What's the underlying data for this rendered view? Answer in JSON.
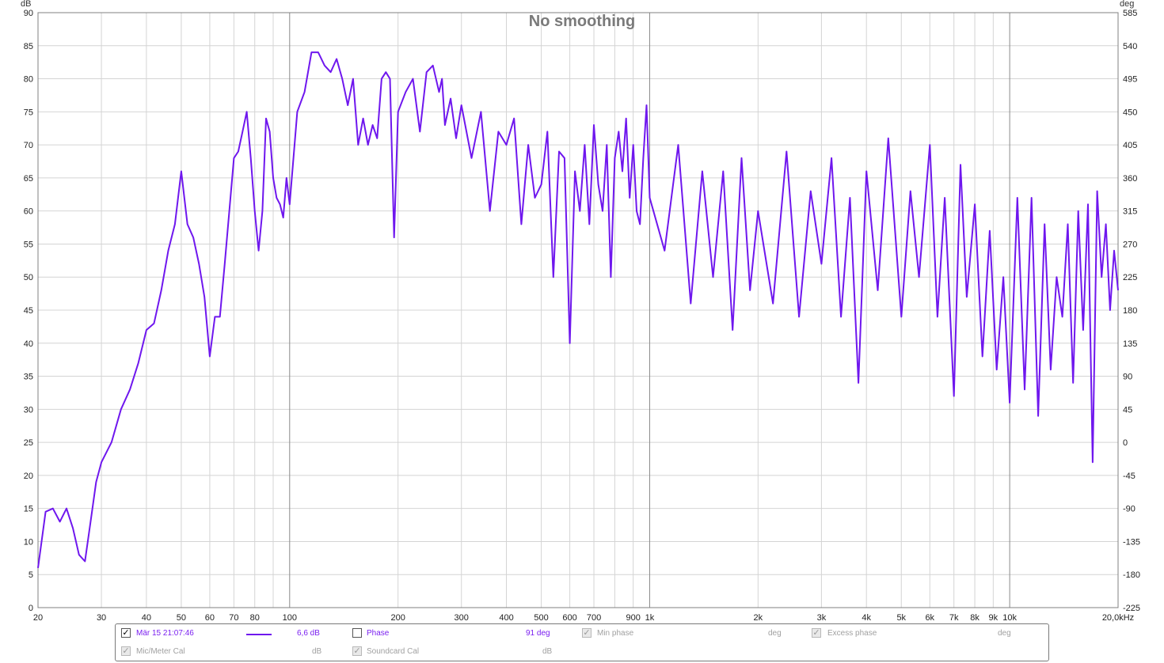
{
  "chart_data": {
    "type": "line",
    "title": "No smoothing",
    "y_left_unit": "dB",
    "y_right_unit": "deg",
    "x_unit_label": "kHz",
    "x_scale": "log",
    "xlim": [
      20,
      20000
    ],
    "ylim": [
      0,
      90
    ],
    "ylim_right": [
      -225,
      585
    ],
    "grid": true,
    "y_ticks": [
      0,
      5,
      10,
      15,
      20,
      25,
      30,
      35,
      40,
      45,
      50,
      55,
      60,
      65,
      70,
      75,
      80,
      85,
      90
    ],
    "y_right_ticks": [
      -225,
      -180,
      -135,
      -90,
      -45,
      0,
      45,
      90,
      135,
      180,
      225,
      270,
      315,
      360,
      405,
      450,
      495,
      540,
      585
    ],
    "x_ticks": [
      {
        "v": 20,
        "label": "20"
      },
      {
        "v": 30,
        "label": "30"
      },
      {
        "v": 40,
        "label": "40"
      },
      {
        "v": 50,
        "label": "50"
      },
      {
        "v": 60,
        "label": "60"
      },
      {
        "v": 70,
        "label": "70"
      },
      {
        "v": 80,
        "label": "80"
      },
      {
        "v": 100,
        "label": "100"
      },
      {
        "v": 200,
        "label": "200"
      },
      {
        "v": 300,
        "label": "300"
      },
      {
        "v": 400,
        "label": "400"
      },
      {
        "v": 500,
        "label": "500"
      },
      {
        "v": 600,
        "label": "600"
      },
      {
        "v": 700,
        "label": "700"
      },
      {
        "v": 900,
        "label": "900"
      },
      {
        "v": 1000,
        "label": "1k"
      },
      {
        "v": 2000,
        "label": "2k"
      },
      {
        "v": 3000,
        "label": "3k"
      },
      {
        "v": 4000,
        "label": "4k"
      },
      {
        "v": 5000,
        "label": "5k"
      },
      {
        "v": 6000,
        "label": "6k"
      },
      {
        "v": 7000,
        "label": "7k"
      },
      {
        "v": 8000,
        "label": "8k"
      },
      {
        "v": 9000,
        "label": "9k"
      },
      {
        "v": 10000,
        "label": "10k"
      },
      {
        "v": 20000,
        "label": "20,0kHz"
      }
    ],
    "series": [
      {
        "color": "#6f17ee",
        "x": [
          20,
          21,
          22,
          23,
          24,
          25,
          26,
          27,
          28,
          29,
          30,
          32,
          34,
          36,
          38,
          40,
          42,
          44,
          46,
          48,
          50,
          52,
          54,
          56,
          58,
          60,
          62,
          64,
          66,
          68,
          70,
          72,
          74,
          76,
          78,
          80,
          82,
          84,
          86,
          88,
          90,
          92,
          94,
          96,
          98,
          100,
          105,
          110,
          115,
          120,
          125,
          130,
          135,
          140,
          145,
          150,
          155,
          160,
          165,
          170,
          175,
          180,
          185,
          190,
          195,
          200,
          210,
          220,
          230,
          240,
          250,
          260,
          265,
          270,
          280,
          290,
          300,
          320,
          340,
          360,
          380,
          400,
          420,
          440,
          460,
          480,
          500,
          520,
          540,
          560,
          580,
          600,
          620,
          640,
          660,
          680,
          700,
          720,
          740,
          760,
          780,
          800,
          820,
          840,
          860,
          880,
          900,
          920,
          940,
          960,
          980,
          1000,
          1100,
          1200,
          1300,
          1400,
          1500,
          1600,
          1700,
          1800,
          1900,
          2000,
          2200,
          2400,
          2600,
          2800,
          3000,
          3200,
          3400,
          3600,
          3800,
          4000,
          4300,
          4600,
          5000,
          5300,
          5600,
          6000,
          6300,
          6600,
          7000,
          7300,
          7600,
          8000,
          8400,
          8800,
          9200,
          9600,
          10000,
          10500,
          11000,
          11500,
          12000,
          12500,
          13000,
          13500,
          14000,
          14500,
          15000,
          15500,
          16000,
          16500,
          17000,
          17500,
          18000,
          18500,
          19000,
          19500,
          20000
        ],
        "y": [
          6,
          14.5,
          15,
          13,
          15,
          12,
          8,
          7,
          13,
          19,
          22,
          25,
          30,
          33,
          37,
          42,
          43,
          48,
          54,
          58,
          66,
          58,
          56,
          52,
          47,
          38,
          44,
          44,
          52,
          60,
          68,
          69,
          72,
          75,
          68,
          60,
          54,
          60,
          74,
          72,
          65,
          62,
          61,
          59,
          65,
          61,
          75,
          78,
          84,
          84,
          82,
          81,
          83,
          80,
          76,
          80,
          70,
          74,
          70,
          73,
          71,
          80,
          81,
          80,
          56,
          75,
          78,
          80,
          72,
          81,
          82,
          78,
          80,
          73,
          77,
          71,
          76,
          68,
          75,
          60,
          72,
          70,
          74,
          58,
          70,
          62,
          64,
          72,
          50,
          69,
          68,
          40,
          66,
          60,
          70,
          58,
          73,
          64,
          60,
          70,
          50,
          68,
          72,
          66,
          74,
          62,
          70,
          60,
          58,
          68,
          76,
          62,
          54,
          70,
          46,
          66,
          50,
          66,
          42,
          68,
          48,
          60,
          46,
          69,
          44,
          63,
          52,
          68,
          44,
          62,
          34,
          66,
          48,
          71,
          44,
          63,
          50,
          70,
          44,
          62,
          32,
          67,
          47,
          61,
          38,
          57,
          36,
          50,
          31,
          62,
          33,
          62,
          29,
          58,
          36,
          50,
          44,
          58,
          34,
          60,
          42,
          61,
          22,
          63,
          50,
          58,
          45,
          54,
          48
        ]
      }
    ]
  },
  "legend": {
    "row1": {
      "trace_checked": true,
      "trace_label": "Mär 15 21:07:46",
      "trace_value": "6,6 dB",
      "phase_checked": false,
      "phase_label": "Phase",
      "phase_value": "91 deg",
      "minphase_checked": true,
      "minphase_label": "Min phase",
      "minphase_unit": "deg",
      "excess_checked": true,
      "excess_label": "Excess phase",
      "excess_unit": "deg"
    },
    "row2": {
      "mic_checked": true,
      "mic_label": "Mic/Meter Cal",
      "mic_unit": "dB",
      "sound_checked": true,
      "sound_label": "Soundcard Cal",
      "sound_unit": "dB"
    }
  }
}
